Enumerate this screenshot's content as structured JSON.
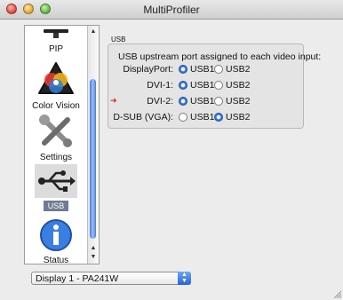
{
  "window": {
    "title": "MultiProfiler"
  },
  "sidebar": {
    "items": [
      {
        "label": "PIP",
        "icon": "pip-icon"
      },
      {
        "label": "Color Vision",
        "icon": "color-vision-icon"
      },
      {
        "label": "Settings",
        "icon": "settings-icon"
      },
      {
        "label": "USB",
        "icon": "usb-icon",
        "selected": true
      },
      {
        "label": "Status",
        "icon": "info-icon"
      }
    ]
  },
  "usb": {
    "group_label": "USB",
    "heading": "USB upstream port assigned to each video input:",
    "rows": [
      {
        "label": "DisplayPort:",
        "selected": "USB1",
        "options": [
          "USB1",
          "USB2"
        ],
        "marker": false
      },
      {
        "label": "DVI-1:",
        "selected": "USB1",
        "options": [
          "USB1",
          "USB2"
        ],
        "marker": false
      },
      {
        "label": "DVI-2:",
        "selected": "USB1",
        "options": [
          "USB1",
          "USB2"
        ],
        "marker": true
      },
      {
        "label": "D-SUB (VGA):",
        "selected": "USB2",
        "options": [
          "USB1",
          "USB2"
        ],
        "marker": false
      }
    ]
  },
  "display_select": {
    "value": "Display 1 - PA241W"
  },
  "colors": {
    "selected_tab": "#6f7c93",
    "accent": "#3a78e0",
    "marker": "#e02020"
  }
}
